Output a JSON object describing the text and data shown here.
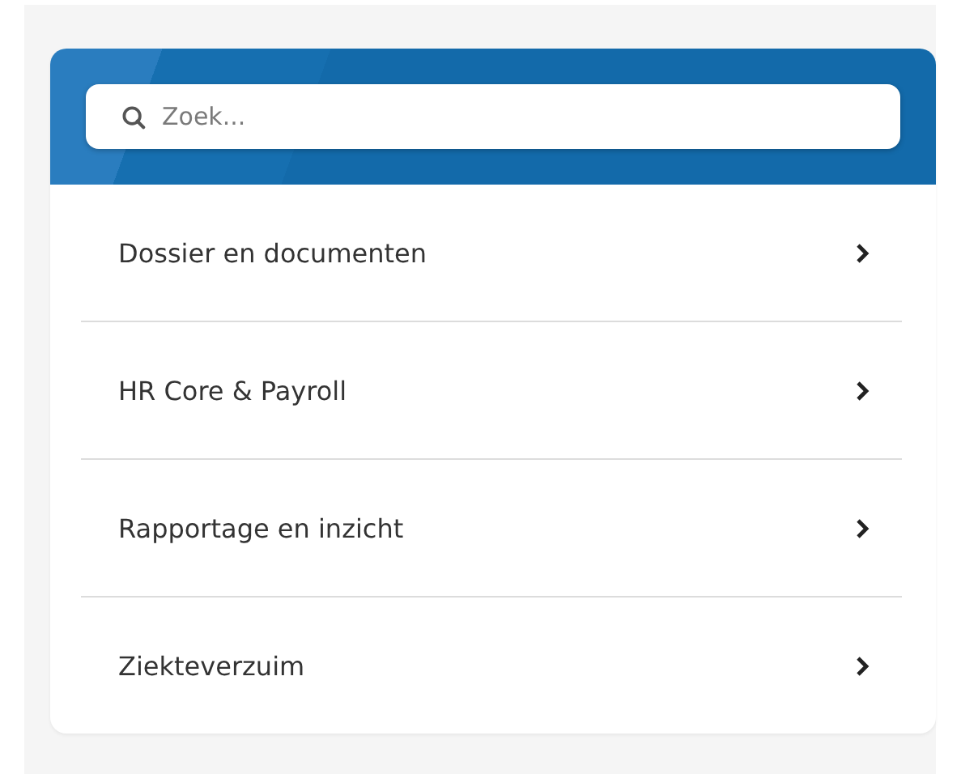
{
  "search": {
    "placeholder": "Zoek..."
  },
  "items": [
    {
      "label": "Dossier en documenten"
    },
    {
      "label": "HR Core & Payroll"
    },
    {
      "label": "Rapportage en inzicht"
    },
    {
      "label": "Ziekteverzuim"
    }
  ]
}
